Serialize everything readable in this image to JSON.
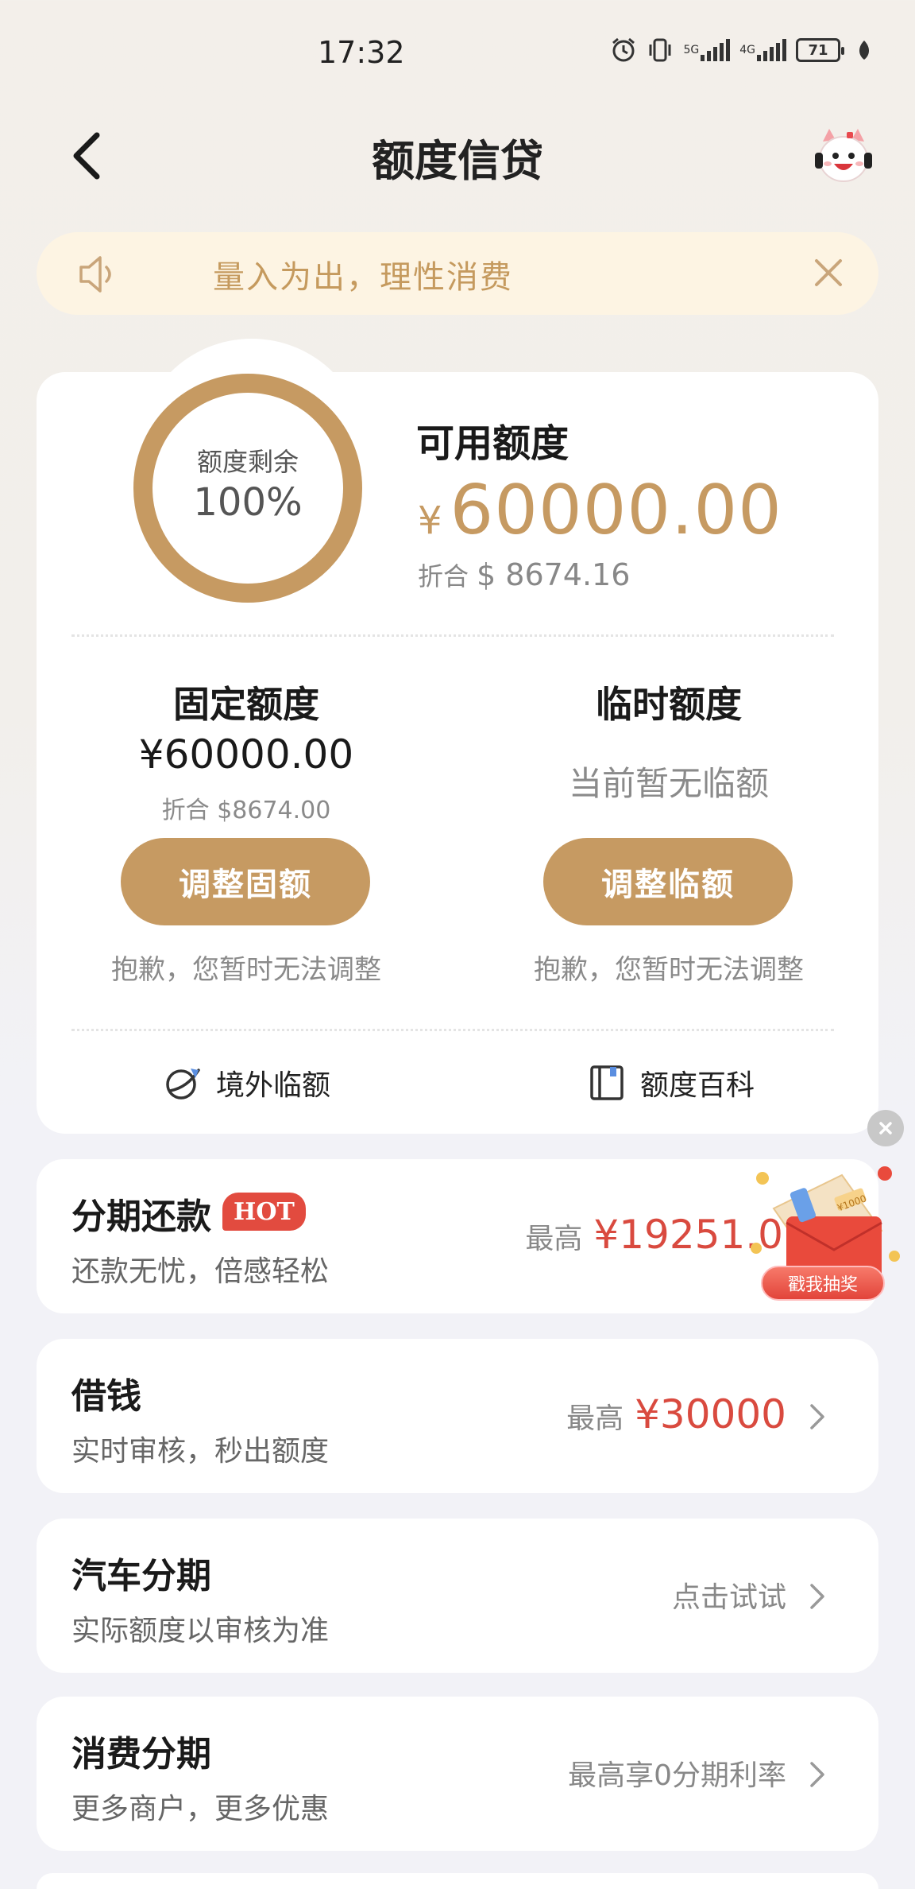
{
  "status_bar": {
    "time": "17:32",
    "network_1": "5G",
    "network_2": "4G",
    "battery": "71"
  },
  "nav": {
    "title": "额度信贷"
  },
  "notice": {
    "text": "量入为出，理性消费"
  },
  "credit": {
    "ring_label": "额度剩余",
    "ring_value": "100%",
    "ring_fraction": 1.0,
    "available_title": "可用额度",
    "currency_symbol": "¥",
    "available_amount": "60000.00",
    "equiv_prefix": "折合",
    "equiv_value": "$ 8674.16",
    "fixed": {
      "title": "固定额度",
      "amount": "¥60000.00",
      "equiv": "折合 $8674.00",
      "button": "调整固额",
      "note": "抱歉，您暂时无法调整"
    },
    "temporary": {
      "title": "临时额度",
      "status": "当前暂无临额",
      "button": "调整临额",
      "note": "抱歉，您暂时无法调整"
    },
    "links": {
      "overseas": "境外临额",
      "encyclopedia": "额度百科"
    }
  },
  "products": [
    {
      "title": "分期还款",
      "badge": "HOT",
      "subtitle": "还款无忧，倍感轻松",
      "prefix": "最高",
      "amount": "¥19251.0"
    },
    {
      "title": "借钱",
      "subtitle": "实时审核，秒出额度",
      "prefix": "最高",
      "amount": "¥30000"
    },
    {
      "title": "汽车分期",
      "subtitle": "实际额度以审核为准",
      "cta": "点击试试"
    },
    {
      "title": "消费分期",
      "subtitle": "更多商户，更多优惠",
      "cta": "最高享0分期利率"
    }
  ],
  "promo": {
    "button": "戳我抽奖",
    "tag": "¥1000"
  },
  "colors": {
    "accent_gold": "#c69a62",
    "notice_bg": "#fdf4e3",
    "amount_red": "#d94a3f",
    "hot_red": "#e24b3f"
  }
}
